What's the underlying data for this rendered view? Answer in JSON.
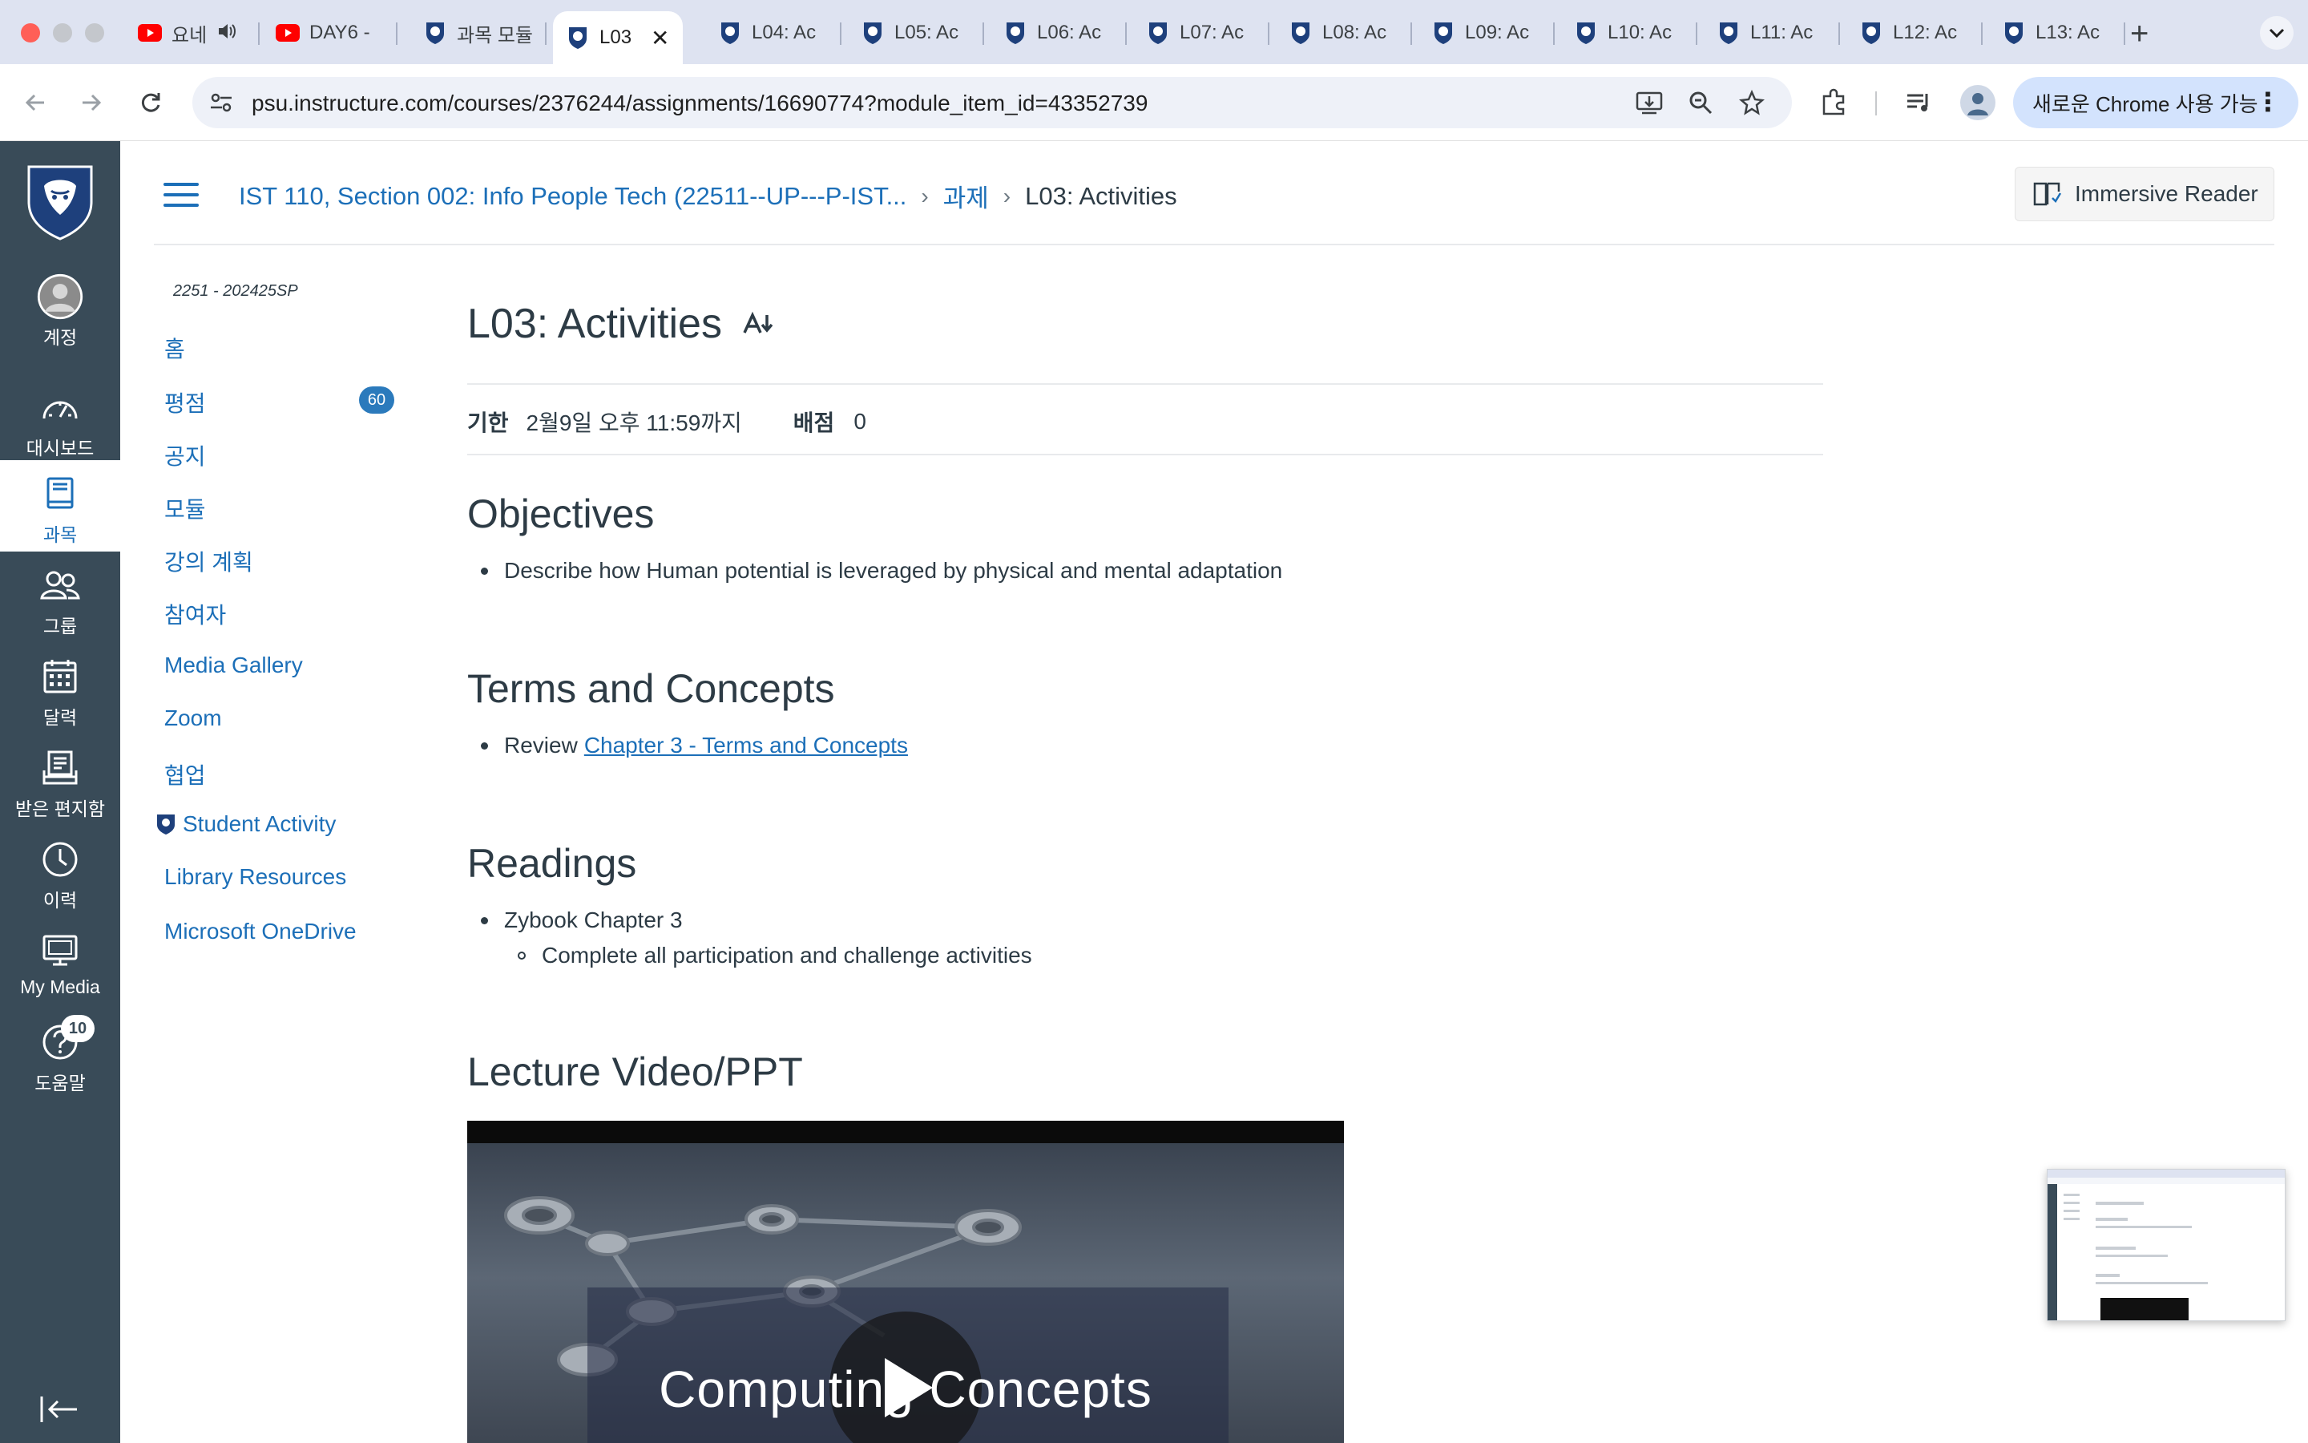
{
  "browser": {
    "tabs": [
      {
        "title": "요네",
        "favicon": "youtube-icon",
        "audio": true
      },
      {
        "title": "DAY6 -",
        "favicon": "youtube-icon"
      },
      {
        "title": "과목 모듈",
        "favicon": "psu-shield-icon"
      },
      {
        "title": "L03",
        "favicon": "psu-shield-icon",
        "active": true
      },
      {
        "title": "L04: Ac",
        "favicon": "psu-shield-icon"
      },
      {
        "title": "L05: Ac",
        "favicon": "psu-shield-icon"
      },
      {
        "title": "L06: Ac",
        "favicon": "psu-shield-icon"
      },
      {
        "title": "L07: Ac",
        "favicon": "psu-shield-icon"
      },
      {
        "title": "L08: Ac",
        "favicon": "psu-shield-icon"
      },
      {
        "title": "L09: Ac",
        "favicon": "psu-shield-icon"
      },
      {
        "title": "L10: Ac",
        "favicon": "psu-shield-icon"
      },
      {
        "title": "L11: Ac",
        "favicon": "psu-shield-icon"
      },
      {
        "title": "L12: Ac",
        "favicon": "psu-shield-icon"
      },
      {
        "title": "L13: Ac",
        "favicon": "psu-shield-icon"
      }
    ],
    "url": "psu.instructure.com/courses/2376244/assignments/16690774?module_item_id=43352739",
    "chrome_update": "새로운 Chrome 사용 가능"
  },
  "global_nav": {
    "items": [
      {
        "label": "계정",
        "icon": "account-avatar-icon"
      },
      {
        "label": "대시보드",
        "icon": "dashboard-icon"
      },
      {
        "label": "과목",
        "icon": "courses-icon",
        "active": true
      },
      {
        "label": "그룹",
        "icon": "groups-icon"
      },
      {
        "label": "달력",
        "icon": "calendar-icon"
      },
      {
        "label": "받은 편지함",
        "icon": "inbox-icon"
      },
      {
        "label": "이력",
        "icon": "history-icon"
      },
      {
        "label": "My Media",
        "icon": "my-media-icon"
      },
      {
        "label": "도움말",
        "icon": "help-icon",
        "badge": "10"
      }
    ]
  },
  "header": {
    "breadcrumb": {
      "course": "IST 110, Section 002: Info People Tech (22511--UP---P-IST...",
      "section": "과제",
      "current": "L03: Activities"
    },
    "immersive_reader": "Immersive Reader"
  },
  "course_nav": {
    "term": "2251 - 202425SP",
    "items": [
      {
        "label": "홈"
      },
      {
        "label": "평점",
        "badge": "60"
      },
      {
        "label": "공지"
      },
      {
        "label": "모듈"
      },
      {
        "label": "강의 계획"
      },
      {
        "label": "참여자"
      },
      {
        "label": "Media Gallery"
      },
      {
        "label": "Zoom"
      },
      {
        "label": "협업"
      },
      {
        "label": "Student Activity",
        "icon": "psu-shield-icon"
      },
      {
        "label": "Library Resources"
      },
      {
        "label": "Microsoft OneDrive"
      }
    ]
  },
  "assignment": {
    "title": "L03: Activities",
    "due_label": "기한",
    "due_value": "2월9일 오후 11:59까지",
    "points_label": "배점",
    "points_value": "0",
    "sections": {
      "objectives": {
        "heading": "Objectives",
        "items": [
          "Describe how Human potential is leveraged by physical and mental adaptation"
        ]
      },
      "terms": {
        "heading": "Terms and Concepts",
        "prefix": "Review",
        "link": "Chapter 3 - Terms and Concepts"
      },
      "readings": {
        "heading": "Readings",
        "item": "Zybook Chapter 3",
        "subitem": "Complete all participation and challenge activities"
      },
      "lecture": {
        "heading": "Lecture Video/PPT",
        "video_title": "Computing Concepts"
      }
    }
  },
  "colors": {
    "canvas_nav_bg": "#394b58",
    "link_blue": "#1c6fb8",
    "tabstrip_bg": "#dee3f1"
  }
}
